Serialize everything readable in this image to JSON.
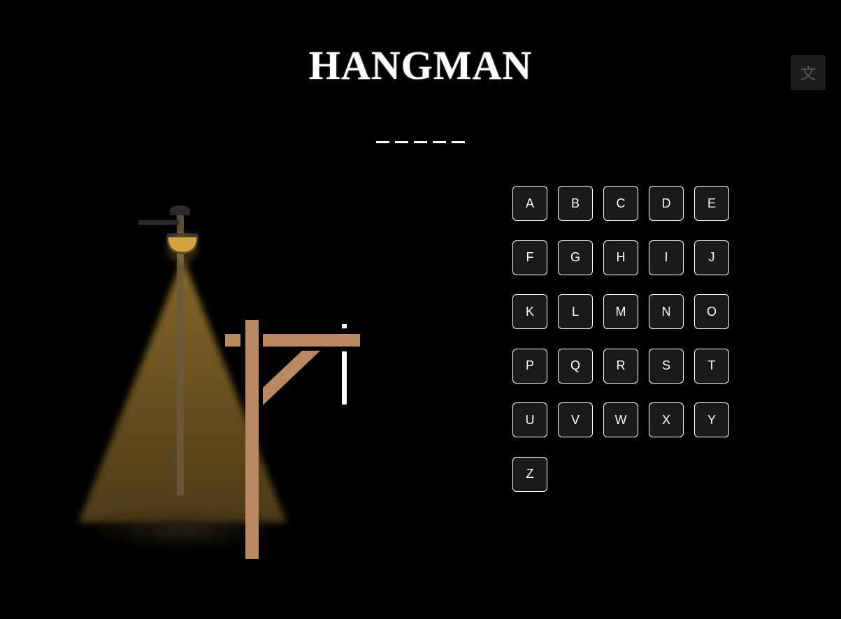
{
  "title": "HANGMAN",
  "language_button": {
    "icon": "translate-icon",
    "glyph": "文"
  },
  "word": {
    "blanks": [
      "_",
      "_",
      "_",
      "_",
      "_"
    ]
  },
  "keyboard": {
    "letters": [
      "A",
      "B",
      "C",
      "D",
      "E",
      "F",
      "G",
      "H",
      "I",
      "J",
      "K",
      "L",
      "M",
      "N",
      "O",
      "P",
      "Q",
      "R",
      "S",
      "T",
      "U",
      "V",
      "W",
      "X",
      "Y",
      "Z"
    ]
  },
  "scene": {
    "lamp": "street-lamp-icon",
    "gallows": "gallows-icon"
  },
  "colors": {
    "background": "#000000",
    "wood": "#b98a62",
    "lamp_light": "#d4a441",
    "key_background": "#1a1a1a",
    "key_border": "#ffffff"
  }
}
